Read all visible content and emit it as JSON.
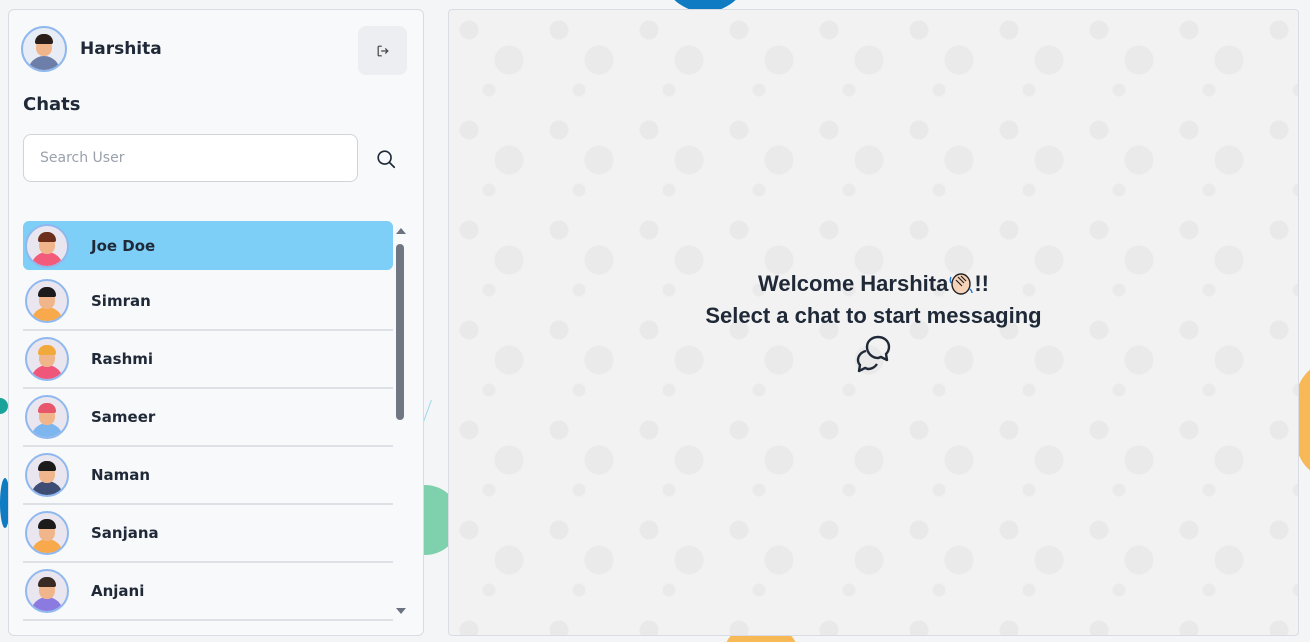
{
  "user": {
    "name": "Harshita"
  },
  "sidebar": {
    "title": "Chats",
    "search_placeholder": "Search User",
    "chats": [
      {
        "name": "Joe Doe",
        "active": true,
        "shirt": "#f25b7a",
        "hair": "#6b2f1b"
      },
      {
        "name": "Simran",
        "active": false,
        "shirt": "#f7a94b",
        "hair": "#1b1b1b"
      },
      {
        "name": "Rashmi",
        "active": false,
        "shirt": "#f0557a",
        "hair": "#f2a93b"
      },
      {
        "name": "Sameer",
        "active": false,
        "shirt": "#7db6ee",
        "hair": "#e8566b"
      },
      {
        "name": "Naman",
        "active": false,
        "shirt": "#3d4d73",
        "hair": "#1b1b1b"
      },
      {
        "name": "Sanjana",
        "active": false,
        "shirt": "#f7a94b",
        "hair": "#1b1b1b"
      },
      {
        "name": "Anjani",
        "active": false,
        "shirt": "#8b7be0",
        "hair": "#3a2a24"
      }
    ]
  },
  "main": {
    "welcome_prefix": "Welcome Harshita",
    "welcome_suffix": "!!",
    "subtitle": "Select a chat to start messaging"
  },
  "colors": {
    "active_chat": "#7dcff8",
    "text": "#1f2937"
  }
}
